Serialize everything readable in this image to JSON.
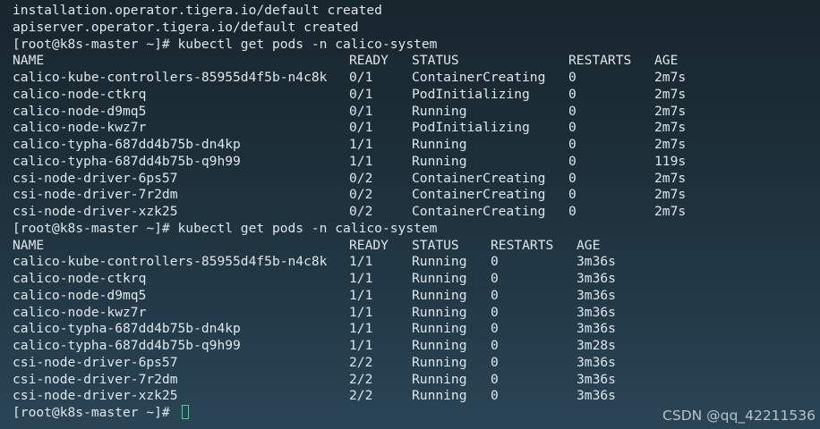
{
  "terminal": {
    "pre_lines": [
      "installation.operator.tigera.io/default created",
      "apiserver.operator.tigera.io/default created"
    ],
    "prompt": "[root@k8s-master ~]# ",
    "command": "kubectl get pods -n calico-system",
    "headers": [
      "NAME",
      "READY",
      "STATUS",
      "RESTARTS",
      "AGE"
    ],
    "table1": [
      [
        "calico-kube-controllers-85955d4f5b-n4c8k",
        "0/1",
        "ContainerCreating",
        "0",
        "2m7s"
      ],
      [
        "calico-node-ctkrq",
        "0/1",
        "PodInitializing",
        "0",
        "2m7s"
      ],
      [
        "calico-node-d9mq5",
        "0/1",
        "Running",
        "0",
        "2m7s"
      ],
      [
        "calico-node-kwz7r",
        "0/1",
        "PodInitializing",
        "0",
        "2m7s"
      ],
      [
        "calico-typha-687dd4b75b-dn4kp",
        "1/1",
        "Running",
        "0",
        "2m7s"
      ],
      [
        "calico-typha-687dd4b75b-q9h99",
        "1/1",
        "Running",
        "0",
        "119s"
      ],
      [
        "csi-node-driver-6ps57",
        "0/2",
        "ContainerCreating",
        "0",
        "2m7s"
      ],
      [
        "csi-node-driver-7r2dm",
        "0/2",
        "ContainerCreating",
        "0",
        "2m7s"
      ],
      [
        "csi-node-driver-xzk25",
        "0/2",
        "ContainerCreating",
        "0",
        "2m7s"
      ]
    ],
    "table2": [
      [
        "calico-kube-controllers-85955d4f5b-n4c8k",
        "1/1",
        "Running",
        "0",
        "3m36s"
      ],
      [
        "calico-node-ctkrq",
        "1/1",
        "Running",
        "0",
        "3m36s"
      ],
      [
        "calico-node-d9mq5",
        "1/1",
        "Running",
        "0",
        "3m36s"
      ],
      [
        "calico-node-kwz7r",
        "1/1",
        "Running",
        "0",
        "3m36s"
      ],
      [
        "calico-typha-687dd4b75b-dn4kp",
        "1/1",
        "Running",
        "0",
        "3m36s"
      ],
      [
        "calico-typha-687dd4b75b-q9h99",
        "1/1",
        "Running",
        "0",
        "3m28s"
      ],
      [
        "csi-node-driver-6ps57",
        "2/2",
        "Running",
        "0",
        "3m36s"
      ],
      [
        "csi-node-driver-7r2dm",
        "2/2",
        "Running",
        "0",
        "3m36s"
      ],
      [
        "csi-node-driver-xzk25",
        "2/2",
        "Running",
        "0",
        "3m36s"
      ]
    ],
    "cursor_color": "#3ddc84"
  },
  "watermark": "CSDN @qq_42211536"
}
